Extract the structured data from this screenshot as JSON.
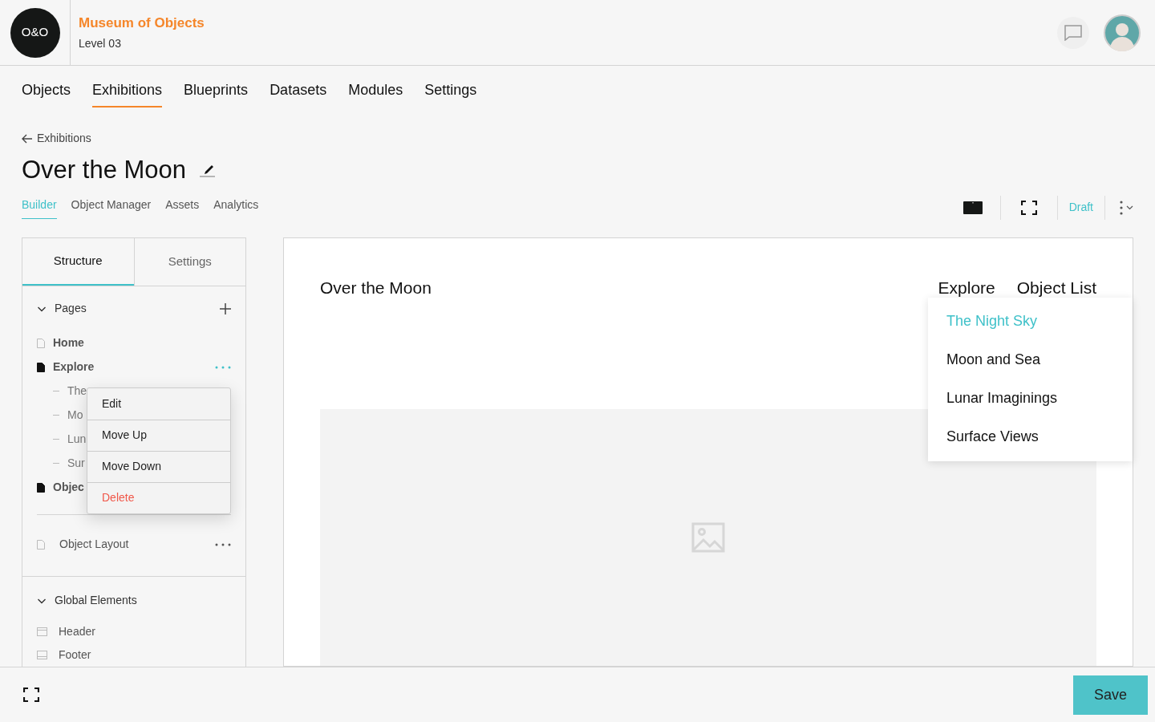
{
  "header": {
    "logo": "O&O",
    "org": "Museum of Objects",
    "level": "Level 03"
  },
  "nav": [
    {
      "label": "Objects",
      "selected": false
    },
    {
      "label": "Exhibitions",
      "selected": true
    },
    {
      "label": "Blueprints",
      "selected": false
    },
    {
      "label": "Datasets",
      "selected": false
    },
    {
      "label": "Modules",
      "selected": false
    },
    {
      "label": "Settings",
      "selected": false
    }
  ],
  "breadcrumb": "Exhibitions",
  "title": "Over the Moon",
  "subtabs": [
    {
      "label": "Builder",
      "selected": true
    },
    {
      "label": "Object Manager",
      "selected": false
    },
    {
      "label": "Assets",
      "selected": false
    },
    {
      "label": "Analytics",
      "selected": false
    }
  ],
  "status": "Draft",
  "sidebar": {
    "tabs": [
      {
        "label": "Structure",
        "selected": true
      },
      {
        "label": "Settings",
        "selected": false
      }
    ],
    "pages": {
      "title": "Pages",
      "expanded": true,
      "items": [
        {
          "label": "Home",
          "filled": false
        },
        {
          "label": "Explore",
          "filled": true,
          "children": [
            {
              "label": "The"
            },
            {
              "label": "Mo"
            },
            {
              "label": "Lun"
            },
            {
              "label": "Sur"
            }
          ]
        },
        {
          "label": "Objec",
          "filled": true
        }
      ],
      "template": "Object Layout"
    },
    "global": {
      "title": "Global Elements",
      "expanded": true,
      "items": [
        {
          "label": "Header",
          "kind": "header"
        },
        {
          "label": "Footer",
          "kind": "footer"
        }
      ]
    }
  },
  "context_menu": [
    {
      "label": "Edit",
      "kind": "normal"
    },
    {
      "label": "Move Up",
      "kind": "normal"
    },
    {
      "label": "Move Down",
      "kind": "normal"
    },
    {
      "label": "Delete",
      "kind": "danger"
    }
  ],
  "preview": {
    "title": "Over the Moon",
    "nav": [
      "Explore",
      "Object List"
    ],
    "dropdown": [
      {
        "label": "The Night Sky",
        "selected": true
      },
      {
        "label": "Moon and Sea",
        "selected": false
      },
      {
        "label": "Lunar Imaginings",
        "selected": false
      },
      {
        "label": "Surface Views",
        "selected": false
      }
    ]
  },
  "save": "Save"
}
